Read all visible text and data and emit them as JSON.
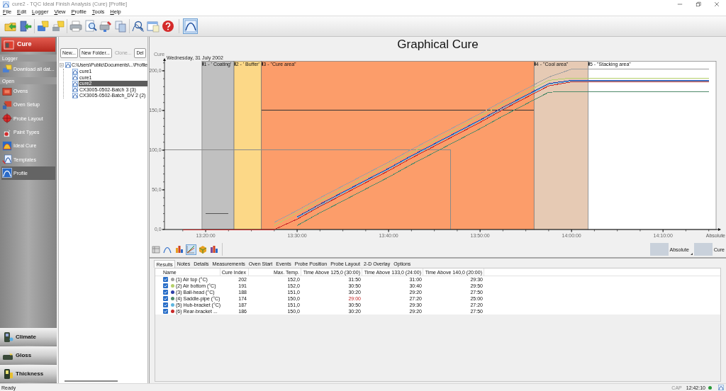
{
  "window": {
    "title": "cure2 - TQC Ideal Finish Analysis (Cure) [Profile]"
  },
  "menu": [
    "File",
    "Edit",
    "Logger",
    "View",
    "Profile",
    "Tools",
    "Help"
  ],
  "toolbar": [
    {
      "pressed": false
    },
    {
      "pressed": false
    },
    {
      "pressed": false
    },
    {
      "pressed": false
    },
    {
      "pressed": false
    },
    {
      "pressed": false
    },
    {
      "pressed": false
    },
    {
      "pressed": false
    },
    {
      "pressed": false
    },
    {
      "pressed": false
    },
    {
      "pressed": false
    },
    {
      "pressed": true
    }
  ],
  "sidebar": {
    "header": "Cure",
    "sections": [
      {
        "title": "Logger",
        "items": [
          {
            "label": "Download all dat...",
            "selected": false
          }
        ]
      },
      {
        "title": "Open",
        "items": [
          {
            "label": "Ovens",
            "selected": false
          },
          {
            "label": "Oven Setup",
            "selected": false
          },
          {
            "label": "Probe Layout",
            "selected": false
          },
          {
            "label": "Paint Types",
            "selected": false
          },
          {
            "label": "Ideal Cure",
            "selected": false
          },
          {
            "label": "Templates",
            "selected": false
          },
          {
            "label": "Profile",
            "selected": true
          }
        ]
      }
    ],
    "modules": [
      "Climate",
      "Gloss",
      "Thickness"
    ]
  },
  "tree": {
    "buttons": [
      {
        "label": "New...",
        "disabled": false
      },
      {
        "label": "New Folder...",
        "disabled": false
      },
      {
        "label": "Clone...",
        "disabled": true
      },
      {
        "label": "Del",
        "disabled": false
      }
    ],
    "root": {
      "label": "C:\\Users\\Public\\Documents\\...\\Profile",
      "expanded": true,
      "children": [
        {
          "label": "cure1",
          "selected": false
        },
        {
          "label": "cure1",
          "selected": false
        },
        {
          "label": "cure2",
          "selected": true
        },
        {
          "label": "CX3005-0502-Batch 3 (3)",
          "selected": false
        },
        {
          "label": "CX3005-0502-Batch_DV 2 (2)",
          "selected": false
        }
      ]
    }
  },
  "graph": {
    "date": "Wednesday, 31 July 2002",
    "zones": [
      {
        "label": "1 - ' Coating'",
        "color": "#c0c0c0"
      },
      {
        "label": "2 - ' Buffer'",
        "color": "#fcd887"
      },
      {
        "label": "3 - \"Cure area\"",
        "color": "#fc9d6a"
      },
      {
        "label": "4 - \"Cool area\"",
        "color": "#e6cab4"
      },
      {
        "label": "5 - \"Stacking area\"",
        "color": "#ffffff"
      }
    ],
    "chart_data": {
      "type": "line",
      "title": "Graphical Cure",
      "xlabel": "Absolute",
      "ylabel": "Cure",
      "categories": [
        null,
        "13:20:00",
        null,
        null,
        null,
        "13:30:00",
        null,
        null,
        null,
        "13:40:00",
        null,
        null,
        null,
        "13:50:00",
        null,
        null,
        null,
        "14:00:00",
        null,
        null,
        null,
        "14:10:00",
        null,
        null
      ],
      "series": [
        {
          "color": "#a0a0a0",
          "values": [
            null,
            null,
            null,
            null,
            9,
            24,
            40,
            55,
            70,
            85,
            101,
            116,
            131,
            146,
            162,
            177,
            192,
            202,
            202,
            202,
            202,
            202,
            202,
            202
          ]
        },
        {
          "color": "#b5d06a",
          "values": [
            null,
            null,
            null,
            null,
            5,
            21,
            36,
            51,
            66,
            82,
            97,
            112,
            127,
            143,
            158,
            173,
            188,
            191,
            191,
            191,
            191,
            191,
            191,
            191
          ]
        },
        {
          "color": "#2e3fa8",
          "values": [
            null,
            null,
            null,
            null,
            null,
            16,
            32,
            47,
            62,
            77,
            93,
            108,
            123,
            138,
            154,
            169,
            184,
            188,
            188,
            188,
            188,
            188,
            188,
            188
          ]
        },
        {
          "color": "#4f8a6a",
          "values": [
            null,
            null,
            null,
            null,
            null,
            5,
            21,
            36,
            51,
            66,
            82,
            97,
            112,
            127,
            143,
            158,
            173,
            174,
            174,
            174,
            174,
            174,
            174,
            174
          ]
        },
        {
          "color": "#5fb6e0",
          "values": [
            null,
            null,
            null,
            null,
            null,
            15,
            30,
            46,
            61,
            76,
            92,
            107,
            122,
            137,
            152,
            168,
            183,
            187,
            187,
            187,
            187,
            187,
            187,
            187
          ]
        },
        {
          "color": "#c82828",
          "values": [
            0,
            0,
            0,
            0,
            0,
            13,
            29,
            44,
            59,
            74,
            90,
            105,
            120,
            135,
            151,
            166,
            181,
            186,
            186,
            186,
            186,
            186,
            186,
            186
          ]
        },
        {
          "color": "#555555",
          "values": [
            null,
            20,
            20,
            null,
            null,
            null,
            null,
            null,
            null,
            null,
            null,
            null,
            null,
            null,
            null,
            null,
            null,
            null,
            null,
            null,
            null,
            null,
            null,
            null
          ]
        }
      ],
      "ylim": [
        0,
        212
      ],
      "yticks": [
        {
          "value": 0,
          "label": "0,0"
        },
        {
          "value": 50,
          "label": "50,0"
        },
        {
          "value": 100,
          "label": "100,0"
        },
        {
          "value": 150,
          "label": "150,0"
        },
        {
          "value": 200,
          "label": "200,0"
        }
      ],
      "ref_lines": [
        {
          "axis": "y",
          "value": 150,
          "color": "#333333"
        },
        {
          "axis": "y",
          "value": 100,
          "color": "#8a8a8a"
        }
      ]
    }
  },
  "graph_toolbar": [
    {
      "pressed": false
    },
    {
      "pressed": false
    },
    {
      "pressed": false
    },
    {
      "pressed": true
    },
    {
      "pressed": false
    },
    {
      "pressed": false
    }
  ],
  "display_options": [
    {
      "label": "Absolute",
      "has_menu": true
    },
    {
      "label": "Cure",
      "has_menu": false
    }
  ],
  "tabs": [
    {
      "label": "Results",
      "selected": true
    },
    {
      "label": "Notes",
      "selected": false
    },
    {
      "label": "Details",
      "selected": false
    },
    {
      "label": "Measurements",
      "selected": false
    },
    {
      "label": "Oven Start",
      "selected": false
    },
    {
      "label": "Events",
      "selected": false
    },
    {
      "label": "Probe Position",
      "selected": false
    },
    {
      "label": "Probe Layout",
      "selected": false
    },
    {
      "label": "2-D Overlay",
      "selected": false
    },
    {
      "label": "Options",
      "selected": false
    }
  ],
  "results_table": {
    "columns": [
      "Name",
      "Cure Index",
      "Max. Temp.",
      "Time Above 125,0 (30:00)",
      "Time Above 133,0 (24:00)",
      "Time Above 140,0 (20:00)"
    ],
    "rows": [
      {
        "checked": true,
        "color": "#a0a0a0",
        "name": "(1) Air top (°C)",
        "cure_index": "202",
        "max_temp": "152,0",
        "times": [
          {
            "text": "31:50",
            "below_target": false
          },
          {
            "text": "31:00",
            "below_target": false
          },
          {
            "text": "29:30",
            "below_target": false
          }
        ]
      },
      {
        "checked": true,
        "color": "#b5d06a",
        "name": "(2) Air bottom (°C)",
        "cure_index": "191",
        "max_temp": "152,0",
        "times": [
          {
            "text": "30:50",
            "below_target": false
          },
          {
            "text": "30:40",
            "below_target": false
          },
          {
            "text": "29:50",
            "below_target": false
          }
        ]
      },
      {
        "checked": true,
        "color": "#2e3fa8",
        "name": "(3) Ball-head (°C)",
        "cure_index": "188",
        "max_temp": "151,0",
        "times": [
          {
            "text": "30:20",
            "below_target": false
          },
          {
            "text": "29:20",
            "below_target": false
          },
          {
            "text": "27:50",
            "below_target": false
          }
        ]
      },
      {
        "checked": true,
        "color": "#4f8a6a",
        "name": "(4) Saddle-pipe (°C)",
        "cure_index": "174",
        "max_temp": "150,0",
        "times": [
          {
            "text": "29:00",
            "below_target": true
          },
          {
            "text": "27:20",
            "below_target": false
          },
          {
            "text": "25:00",
            "below_target": false
          }
        ]
      },
      {
        "checked": true,
        "color": "#5fb6e0",
        "name": "(5) Hub-bracket (°C)",
        "cure_index": "187",
        "max_temp": "151,0",
        "times": [
          {
            "text": "30:50",
            "below_target": false
          },
          {
            "text": "29:30",
            "below_target": false
          },
          {
            "text": "27:20",
            "below_target": false
          }
        ]
      },
      {
        "checked": true,
        "color": "#c82828",
        "name": "(6) Rear-bracket ...",
        "cure_index": "186",
        "max_temp": "150,0",
        "times": [
          {
            "text": "30:20",
            "below_target": false
          },
          {
            "text": "29:20",
            "below_target": false
          },
          {
            "text": "27:50",
            "below_target": false
          }
        ]
      }
    ]
  },
  "status_bar": {
    "text": "Ready",
    "caps": "CAP",
    "time": "12:42:10",
    "connected": true
  }
}
